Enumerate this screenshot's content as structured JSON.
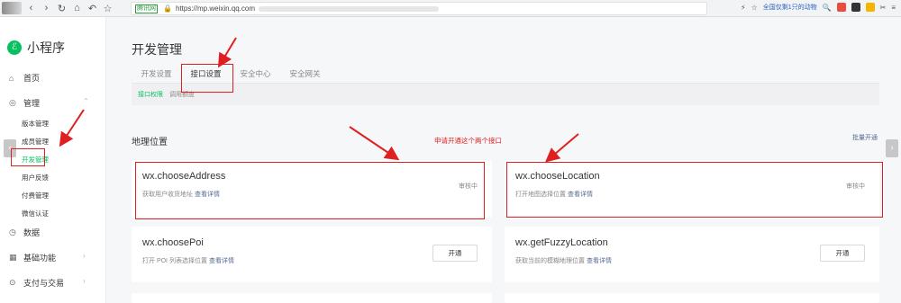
{
  "browser": {
    "nav": [
      "‹",
      "›",
      "↻",
      "⌂",
      "↶",
      "☆"
    ],
    "tag": "腾讯网",
    "url": "https://mp.weixin.qq.com",
    "search_hint": "全国仅剩1只的动物",
    "icons": [
      "lightning-icon",
      "star-icon",
      "search-icon",
      "menu-icon"
    ]
  },
  "sidebar": {
    "logo_text": "小程序",
    "items": [
      {
        "label": "首页",
        "icon": "home-icon"
      },
      {
        "label": "管理",
        "icon": "manage-icon"
      },
      {
        "label": "数据",
        "icon": "data-icon"
      },
      {
        "label": "基础功能",
        "icon": "grid-icon"
      },
      {
        "label": "支付与交易",
        "icon": "pay-icon"
      }
    ],
    "sub_items": [
      "版本管理",
      "成员管理",
      "开发管理",
      "用户反馈",
      "付费管理",
      "微信认证"
    ]
  },
  "main": {
    "title": "开发管理",
    "tabs": [
      "开发设置",
      "接口设置",
      "安全中心",
      "安全网关"
    ],
    "subtabs": [
      "接口权限",
      "调用额度"
    ],
    "section_title": "地理位置",
    "note": "申请开通这个两个接口",
    "batch_link": "批量开通",
    "cards": [
      {
        "name": "wx.chooseAddress",
        "desc": "获取用户收货地址",
        "link": "查看详情",
        "status": "审核中"
      },
      {
        "name": "wx.chooseLocation",
        "desc": "打开地图选择位置",
        "link": "查看详情",
        "status": "审核中"
      },
      {
        "name": "wx.choosePoi",
        "desc": "打开 POI 列表选择位置",
        "link": "查看详情",
        "button": "开通"
      },
      {
        "name": "wx.getFuzzyLocation",
        "desc": "获取当前的模糊地理位置",
        "link": "查看详情",
        "button": "开通"
      }
    ]
  },
  "colors": {
    "accent": "#07c160",
    "annotation": "#e02020",
    "link": "#576b95"
  }
}
